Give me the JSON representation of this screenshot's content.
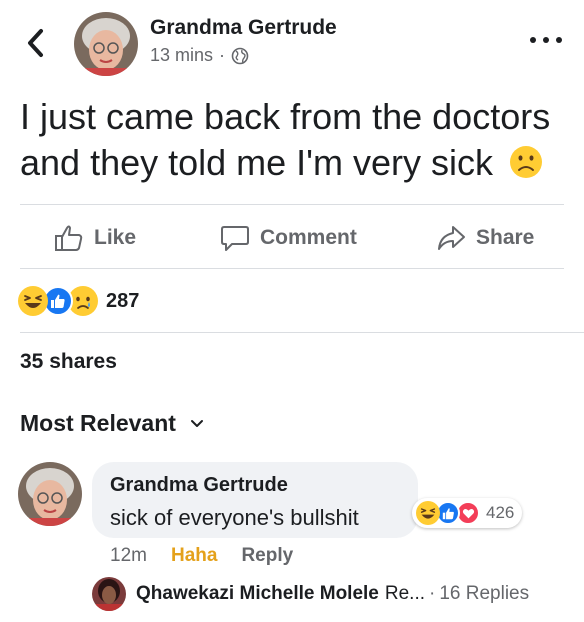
{
  "post": {
    "author": "Grandma Gertrude",
    "time": "13 mins",
    "separator": "·",
    "text": "I just came back from the doctors and they told me I'm very sick",
    "emoji": "sad-face"
  },
  "actions": {
    "like": "Like",
    "comment": "Comment",
    "share": "Share"
  },
  "reactions": {
    "types": [
      "haha",
      "like",
      "sad"
    ],
    "count": "287"
  },
  "shares": "35 shares",
  "sort": {
    "label": "Most Relevant"
  },
  "comment": {
    "author": "Grandma Gertrude",
    "text": "sick of everyone's bullshit",
    "reaction_count": "426",
    "reaction_types": [
      "haha",
      "like",
      "love"
    ],
    "time": "12m",
    "reaction_label": "Haha",
    "reply_label": "Reply"
  },
  "reply_preview": {
    "name": "Qhawekazi Michelle Molele",
    "snippet": "Re...",
    "separator": "·",
    "count": "16 Replies"
  },
  "colors": {
    "accent_haha": "#e4a11b",
    "like_blue": "#1877f2",
    "love_red": "#f33e58",
    "muted_text": "#65676b",
    "divider": "#dadde1",
    "bubble_bg": "#f0f2f5"
  }
}
